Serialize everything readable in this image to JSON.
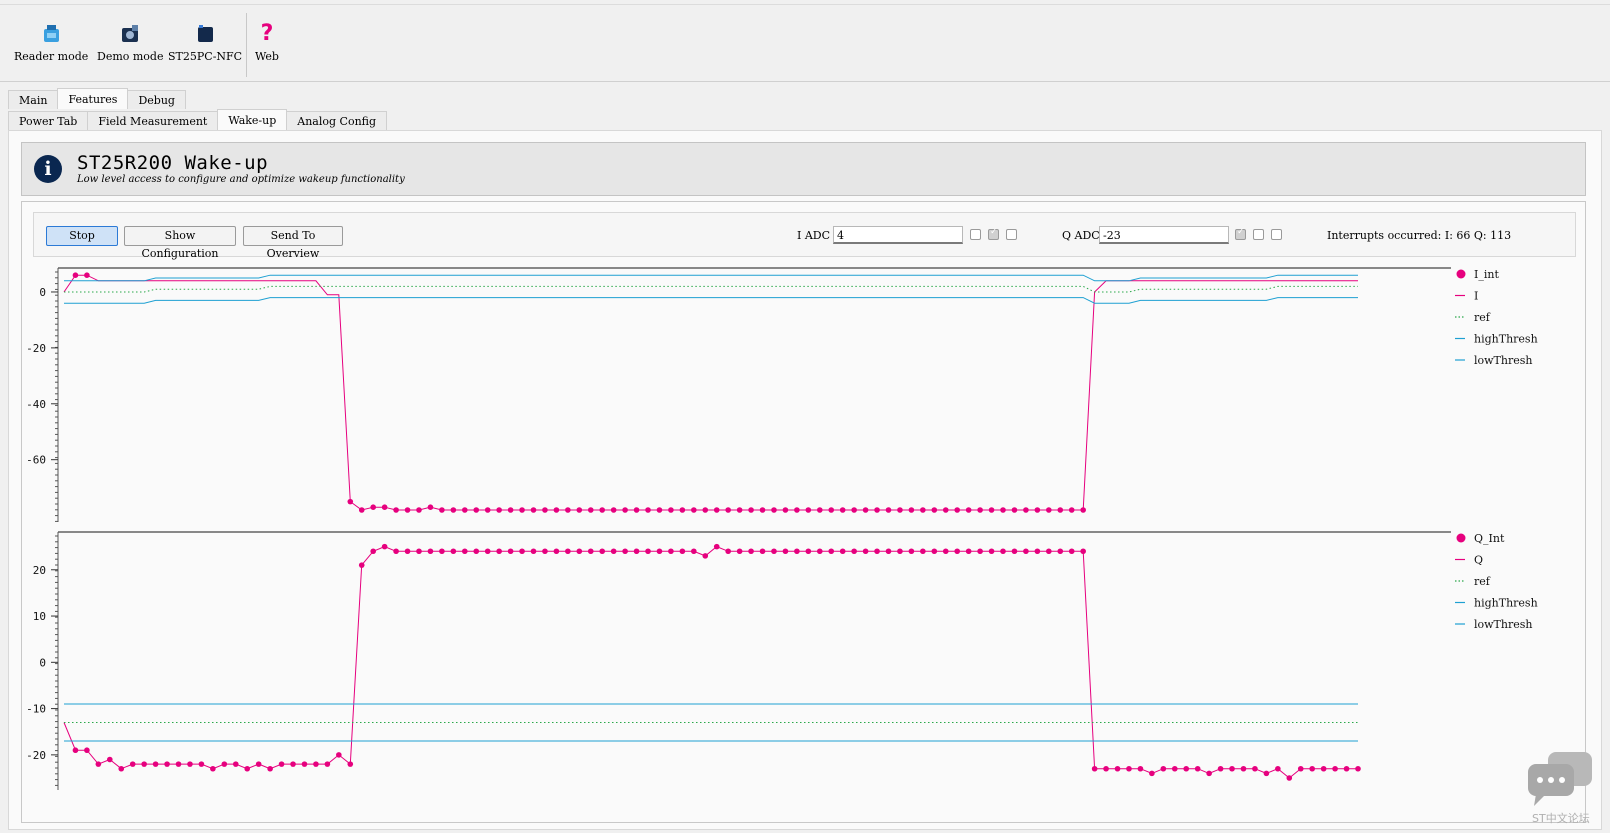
{
  "toolbar": {
    "items": [
      {
        "label": "Reader mode",
        "icon": "reader-mode-icon"
      },
      {
        "label": "Demo mode",
        "icon": "demo-mode-icon"
      },
      {
        "label": "ST25PC-NFC",
        "icon": "board-icon"
      },
      {
        "label": "Web",
        "icon": "help-question-icon"
      }
    ]
  },
  "main_tabs": [
    "Main",
    "Features",
    "Debug"
  ],
  "main_tab_active": "Features",
  "sub_tabs": [
    "Power Tab",
    "Field Measurement",
    "Wake-up",
    "Analog Config"
  ],
  "sub_tab_active": "Wake-up",
  "header": {
    "title": "ST25R200 Wake-up",
    "subtitle": "Low level access to configure and optimize wakeup functionality",
    "icon": "info-icon"
  },
  "controls": {
    "stop_label": "Stop",
    "show_config_label": "Show Configuration",
    "send_overview_label": "Send To Overview",
    "i_adc_label": "I ADC",
    "i_adc_value": "4",
    "i_checks": [
      false,
      true,
      false
    ],
    "q_adc_label": "Q ADC",
    "q_adc_value": "-23",
    "q_checks": [
      true,
      false,
      false
    ],
    "interrupts_text": "Interrupts occurred: I: 66 Q: 113"
  },
  "colors": {
    "signal": "#e6007e",
    "threshold": "#1ea0d2",
    "ref": "#2aa84a",
    "accent": "#2c7ad6",
    "header_icon": "#0a2750"
  },
  "chart_data": [
    {
      "type": "line",
      "ylim": [
        -78,
        5
      ],
      "yticks": [
        0,
        -20,
        -40,
        -60
      ],
      "legend_position": "right",
      "series": [
        {
          "name": "I_int",
          "style": "markers",
          "values": [
            null,
            6,
            6,
            null,
            null,
            null,
            null,
            null,
            null,
            null,
            null,
            null,
            null,
            null,
            null,
            null,
            null,
            null,
            null,
            null,
            null,
            null,
            null,
            null,
            null,
            -75,
            -78,
            -77,
            -77,
            -78,
            -78,
            -78,
            -77,
            -78,
            -78,
            -78,
            -78,
            -78,
            -78,
            -78,
            -78,
            -78,
            -78,
            -78,
            -78,
            -78,
            -78,
            -78,
            -78,
            -78,
            -78,
            -78,
            -78,
            -78,
            -78,
            -78,
            -78,
            -78,
            -78,
            -78,
            -78,
            -78,
            -78,
            -78,
            -78,
            -78,
            -78,
            -78,
            -78,
            -78,
            -78,
            -78,
            -78,
            -78,
            -78,
            -78,
            -78,
            -78,
            -78,
            -78,
            -78,
            -78,
            -78,
            -78,
            -78,
            -78,
            -78,
            -78,
            -78,
            -78,
            null,
            null,
            null,
            null,
            null,
            null,
            null,
            null,
            null,
            null,
            null,
            null,
            null,
            null,
            null,
            null,
            null,
            null,
            null,
            null,
            null,
            null,
            null,
            null
          ]
        },
        {
          "name": "I",
          "style": "line",
          "values": [
            0,
            6,
            6,
            4,
            4,
            4,
            4,
            4,
            4,
            4,
            4,
            4,
            4,
            4,
            4,
            4,
            4,
            4,
            4,
            4,
            4,
            4,
            4,
            -1,
            -1,
            -75,
            -78,
            -77,
            -77,
            -78,
            -78,
            -78,
            -77,
            -78,
            -78,
            -78,
            -78,
            -78,
            -78,
            -78,
            -78,
            -78,
            -78,
            -78,
            -78,
            -78,
            -78,
            -78,
            -78,
            -78,
            -78,
            -78,
            -78,
            -78,
            -78,
            -78,
            -78,
            -78,
            -78,
            -78,
            -78,
            -78,
            -78,
            -78,
            -78,
            -78,
            -78,
            -78,
            -78,
            -78,
            -78,
            -78,
            -78,
            -78,
            -78,
            -78,
            -78,
            -78,
            -78,
            -78,
            -78,
            -78,
            -78,
            -78,
            -78,
            -78,
            -78,
            -78,
            -78,
            -78,
            0,
            4,
            4,
            4,
            4,
            4,
            4,
            4,
            4,
            4,
            4,
            4,
            4,
            4,
            4,
            4,
            4,
            4,
            4,
            4,
            4,
            4,
            4,
            4
          ]
        },
        {
          "name": "ref",
          "style": "dotted",
          "values": [
            0,
            0,
            0,
            0,
            0,
            0,
            0,
            0,
            1,
            1,
            1,
            1,
            1,
            1,
            1,
            1,
            1,
            1,
            2,
            2,
            2,
            2,
            2,
            2,
            2,
            2,
            2,
            2,
            2,
            2,
            2,
            2,
            2,
            2,
            2,
            2,
            2,
            2,
            2,
            2,
            2,
            2,
            2,
            2,
            2,
            2,
            2,
            2,
            2,
            2,
            2,
            2,
            2,
            2,
            2,
            2,
            2,
            2,
            2,
            2,
            2,
            2,
            2,
            2,
            2,
            2,
            2,
            2,
            2,
            2,
            2,
            2,
            2,
            2,
            2,
            2,
            2,
            2,
            2,
            2,
            2,
            2,
            2,
            2,
            2,
            2,
            2,
            2,
            2,
            2,
            0,
            0,
            0,
            0,
            1,
            1,
            1,
            1,
            1,
            1,
            1,
            1,
            1,
            1,
            1,
            1,
            2,
            2,
            2,
            2,
            2,
            2,
            2,
            2
          ]
        },
        {
          "name": "highThresh",
          "style": "line",
          "values": [
            4,
            4,
            4,
            4,
            4,
            4,
            4,
            4,
            5,
            5,
            5,
            5,
            5,
            5,
            5,
            5,
            5,
            5,
            6,
            6,
            6,
            6,
            6,
            6,
            6,
            6,
            6,
            6,
            6,
            6,
            6,
            6,
            6,
            6,
            6,
            6,
            6,
            6,
            6,
            6,
            6,
            6,
            6,
            6,
            6,
            6,
            6,
            6,
            6,
            6,
            6,
            6,
            6,
            6,
            6,
            6,
            6,
            6,
            6,
            6,
            6,
            6,
            6,
            6,
            6,
            6,
            6,
            6,
            6,
            6,
            6,
            6,
            6,
            6,
            6,
            6,
            6,
            6,
            6,
            6,
            6,
            6,
            6,
            6,
            6,
            6,
            6,
            6,
            6,
            6,
            4,
            4,
            4,
            4,
            5,
            5,
            5,
            5,
            5,
            5,
            5,
            5,
            5,
            5,
            5,
            5,
            6,
            6,
            6,
            6,
            6,
            6,
            6,
            6
          ]
        },
        {
          "name": "lowThresh",
          "style": "line",
          "values": [
            -4,
            -4,
            -4,
            -4,
            -4,
            -4,
            -4,
            -4,
            -3,
            -3,
            -3,
            -3,
            -3,
            -3,
            -3,
            -3,
            -3,
            -3,
            -2,
            -2,
            -2,
            -2,
            -2,
            -2,
            -2,
            -2,
            -2,
            -2,
            -2,
            -2,
            -2,
            -2,
            -2,
            -2,
            -2,
            -2,
            -2,
            -2,
            -2,
            -2,
            -2,
            -2,
            -2,
            -2,
            -2,
            -2,
            -2,
            -2,
            -2,
            -2,
            -2,
            -2,
            -2,
            -2,
            -2,
            -2,
            -2,
            -2,
            -2,
            -2,
            -2,
            -2,
            -2,
            -2,
            -2,
            -2,
            -2,
            -2,
            -2,
            -2,
            -2,
            -2,
            -2,
            -2,
            -2,
            -2,
            -2,
            -2,
            -2,
            -2,
            -2,
            -2,
            -2,
            -2,
            -2,
            -2,
            -2,
            -2,
            -2,
            -2,
            -4,
            -4,
            -4,
            -4,
            -3,
            -3,
            -3,
            -3,
            -3,
            -3,
            -3,
            -3,
            -3,
            -3,
            -3,
            -3,
            -2,
            -2,
            -2,
            -2,
            -2,
            -2,
            -2,
            -2
          ]
        }
      ]
    },
    {
      "type": "line",
      "ylim": [
        -25,
        26
      ],
      "yticks": [
        20,
        10,
        0,
        -10,
        -20
      ],
      "legend_position": "right",
      "series": [
        {
          "name": "Q_Int",
          "style": "markers",
          "values": [
            null,
            -19,
            -19,
            -22,
            -21,
            -23,
            -22,
            -22,
            -22,
            -22,
            -22,
            -22,
            -22,
            -23,
            -22,
            -22,
            -23,
            -22,
            -23,
            -22,
            -22,
            -22,
            -22,
            -22,
            -20,
            -22,
            21,
            24,
            25,
            24,
            24,
            24,
            24,
            24,
            24,
            24,
            24,
            24,
            24,
            24,
            24,
            24,
            24,
            24,
            24,
            24,
            24,
            24,
            24,
            24,
            24,
            24,
            24,
            24,
            24,
            24,
            23,
            25,
            24,
            24,
            24,
            24,
            24,
            24,
            24,
            24,
            24,
            24,
            24,
            24,
            24,
            24,
            24,
            24,
            24,
            24,
            24,
            24,
            24,
            24,
            24,
            24,
            24,
            24,
            24,
            24,
            24,
            24,
            24,
            24,
            -23,
            -23,
            -23,
            -23,
            -23,
            -24,
            -23,
            -23,
            -23,
            -23,
            -24,
            -23,
            -23,
            -23,
            -23,
            -24,
            -23,
            -25,
            -23,
            -23,
            -23,
            -23,
            -23,
            -23
          ]
        },
        {
          "name": "Q",
          "style": "line",
          "values": [
            -13,
            -19,
            -19,
            -22,
            -21,
            -23,
            -22,
            -22,
            -22,
            -22,
            -22,
            -22,
            -22,
            -23,
            -22,
            -22,
            -23,
            -22,
            -23,
            -22,
            -22,
            -22,
            -22,
            -22,
            -20,
            -22,
            21,
            24,
            25,
            24,
            24,
            24,
            24,
            24,
            24,
            24,
            24,
            24,
            24,
            24,
            24,
            24,
            24,
            24,
            24,
            24,
            24,
            24,
            24,
            24,
            24,
            24,
            24,
            24,
            24,
            24,
            23,
            25,
            24,
            24,
            24,
            24,
            24,
            24,
            24,
            24,
            24,
            24,
            24,
            24,
            24,
            24,
            24,
            24,
            24,
            24,
            24,
            24,
            24,
            24,
            24,
            24,
            24,
            24,
            24,
            24,
            24,
            24,
            24,
            24,
            -23,
            -23,
            -23,
            -23,
            -23,
            -24,
            -23,
            -23,
            -23,
            -23,
            -24,
            -23,
            -23,
            -23,
            -23,
            -24,
            -23,
            -25,
            -23,
            -23,
            -23,
            -23,
            -23,
            -23
          ]
        },
        {
          "name": "ref",
          "style": "dotted",
          "values": [
            -13,
            -13
          ]
        },
        {
          "name": "highThresh",
          "style": "line",
          "values": [
            -9,
            -9
          ]
        },
        {
          "name": "lowThresh",
          "style": "line",
          "values": [
            -17,
            -17
          ]
        }
      ]
    }
  ]
}
